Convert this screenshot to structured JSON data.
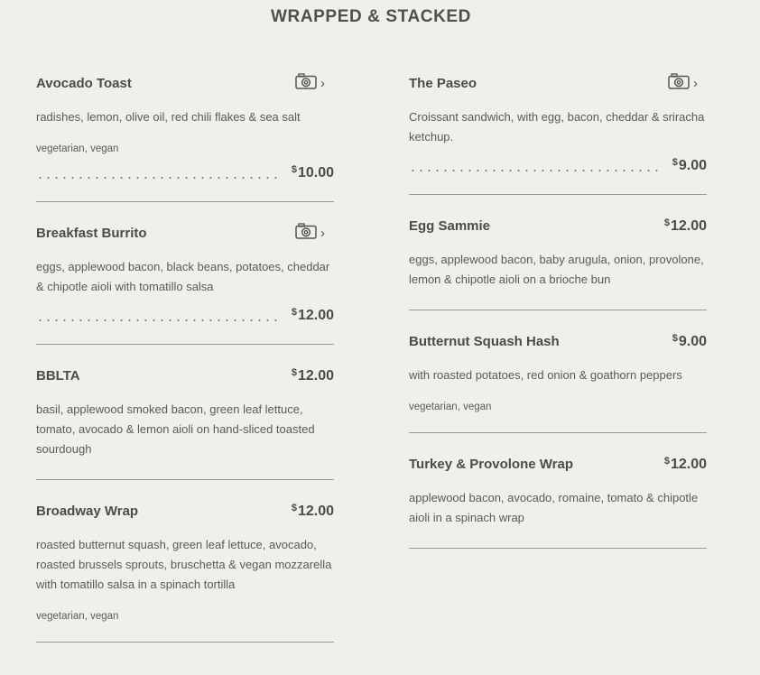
{
  "section": {
    "title": "WRAPPED & STACKED"
  },
  "left_items": [
    {
      "name": "Avocado Toast",
      "description": "radishes, lemon, olive oil, red chili flakes & sea salt",
      "tags": "vegetarian, vegan",
      "currency": "$",
      "price": "10.00",
      "has_photo": true
    },
    {
      "name": "Breakfast Burrito",
      "description": "eggs, applewood bacon, black beans, potatoes, cheddar & chipotle aioli with tomatillo salsa",
      "tags": "",
      "currency": "$",
      "price": "12.00",
      "has_photo": true
    },
    {
      "name": "BBLTA",
      "description": "basil, applewood smoked bacon, green leaf lettuce, tomato, avocado & lemon aioli on hand-sliced toasted sourdough",
      "tags": "",
      "currency": "$",
      "price": "12.00",
      "has_photo": false
    },
    {
      "name": "Broadway Wrap",
      "description": "roasted butternut squash, green leaf lettuce, avocado, roasted brussels sprouts, bruschetta & vegan mozzarella with tomatillo salsa in a spinach tortilla",
      "tags": "vegetarian, vegan",
      "currency": "$",
      "price": "12.00",
      "has_photo": false
    }
  ],
  "right_items": [
    {
      "name": "The Paseo",
      "description": "Croissant sandwich, with egg, bacon, cheddar & sriracha ketchup.",
      "tags": "",
      "currency": "$",
      "price": "9.00",
      "has_photo": true
    },
    {
      "name": "Egg Sammie",
      "description": "eggs, applewood bacon, baby arugula, onion, provolone, lemon & chipotle aioli on a brioche bun",
      "tags": "",
      "currency": "$",
      "price": "12.00",
      "has_photo": false
    },
    {
      "name": "Butternut Squash Hash",
      "description": "with roasted potatoes, red onion & goathorn peppers",
      "tags": "vegetarian, vegan",
      "currency": "$",
      "price": "9.00",
      "has_photo": false
    },
    {
      "name": "Turkey & Provolone Wrap",
      "description": "applewood bacon, avocado, romaine, tomato & chipotle aioli in a spinach wrap",
      "tags": "",
      "currency": "$",
      "price": "12.00",
      "has_photo": false
    }
  ],
  "icons": {
    "photo": "camera-icon",
    "more": "chevron-right-icon"
  }
}
